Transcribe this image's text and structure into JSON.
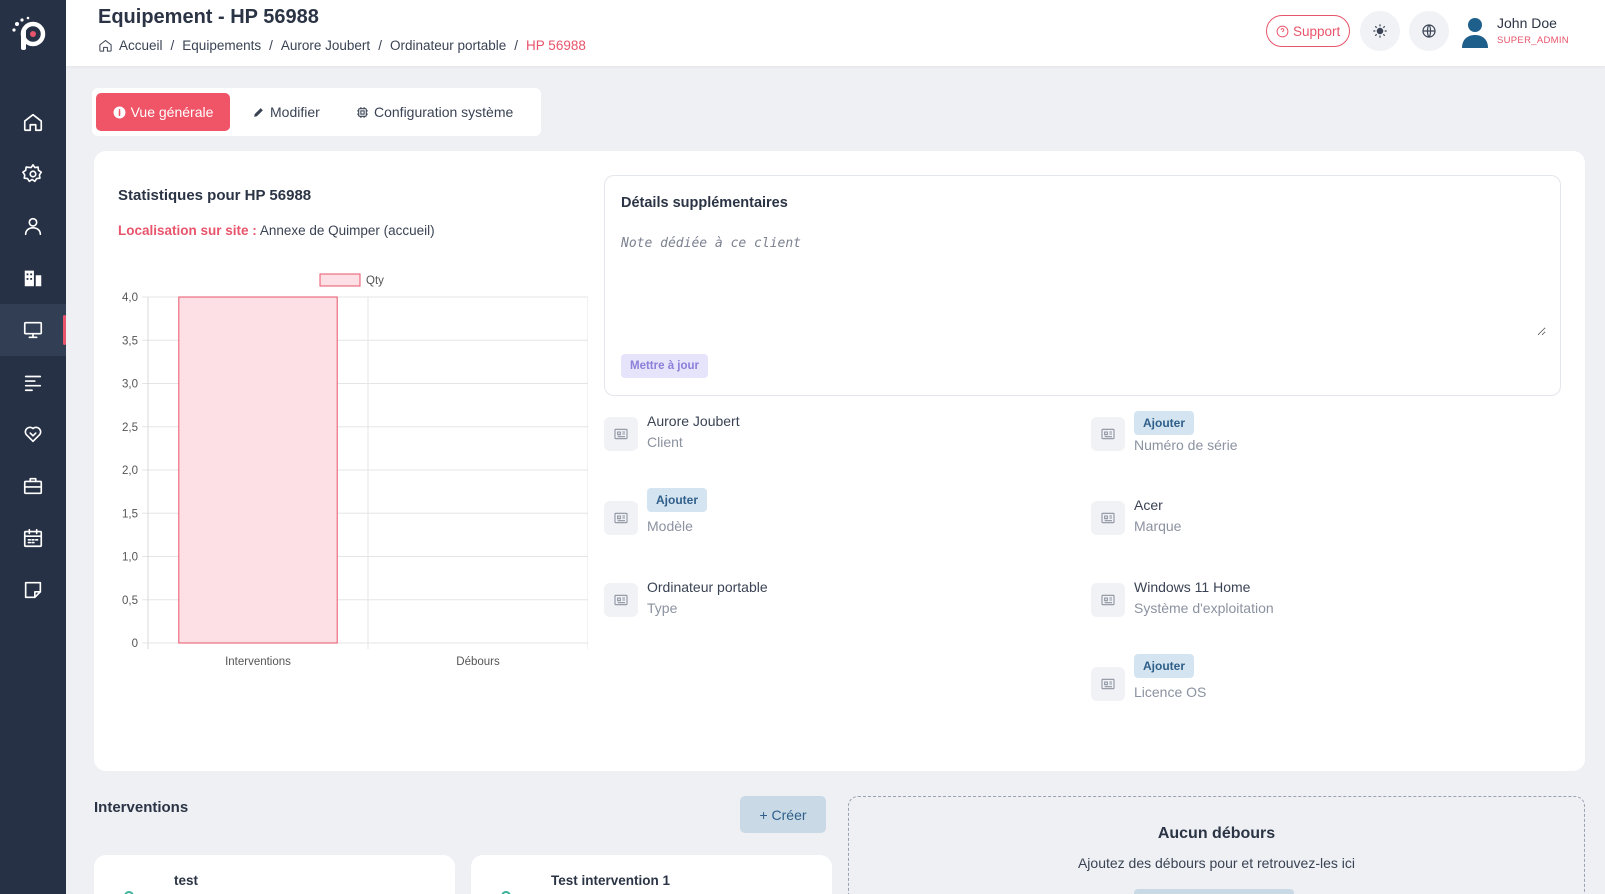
{
  "header": {
    "title": "Equipement - HP 56988",
    "breadcrumb": [
      "Accueil",
      "Equipements",
      "Aurore Joubert",
      "Ordinateur portable",
      "HP 56988"
    ],
    "support_label": "Support",
    "user": {
      "name": "John Doe",
      "role": "SUPER_ADMIN"
    }
  },
  "sidebar": {
    "items": [
      {
        "icon": "home-icon"
      },
      {
        "icon": "settings-icon"
      },
      {
        "icon": "user-icon"
      },
      {
        "icon": "building-icon"
      },
      {
        "icon": "monitor-icon",
        "active": true
      },
      {
        "icon": "list-icon"
      },
      {
        "icon": "heart-handshake-icon"
      },
      {
        "icon": "briefcase-icon"
      },
      {
        "icon": "calendar-icon"
      },
      {
        "icon": "sticky-note-icon"
      }
    ]
  },
  "tabs": [
    {
      "label": "Vue générale",
      "icon": "info-icon",
      "active": true
    },
    {
      "label": "Modifier",
      "icon": "pencil-icon"
    },
    {
      "label": "Configuration système",
      "icon": "cpu-icon"
    }
  ],
  "stats": {
    "title": "Statistiques pour HP 56988",
    "location_label": "Localisation sur site :",
    "location_value": "Annexe de Quimper (accueil)"
  },
  "chart_data": {
    "type": "bar",
    "categories": [
      "Interventions",
      "Débours"
    ],
    "series": [
      {
        "name": "Qty",
        "values": [
          4,
          0
        ]
      }
    ],
    "ylim": [
      0,
      4
    ],
    "yticks": [
      "0",
      "0,5",
      "1,0",
      "1,5",
      "2,0",
      "2,5",
      "3,0",
      "3,5",
      "4,0"
    ],
    "legend": "top",
    "grid": true,
    "colors": {
      "fill": "#fde0e5",
      "stroke": "#e8546b"
    }
  },
  "details": {
    "title": "Détails supplémentaires",
    "note_placeholder": "Note dédiée à ce client",
    "update_label": "Mettre à jour"
  },
  "info": {
    "add_label": "Ajouter",
    "client": {
      "value": "Aurore Joubert",
      "label": "Client"
    },
    "serial": {
      "label": "Numéro de série"
    },
    "model": {
      "label": "Modèle"
    },
    "brand": {
      "value": "Acer",
      "label": "Marque"
    },
    "type": {
      "value": "Ordinateur portable",
      "label": "Type"
    },
    "os": {
      "value": "Windows 11 Home",
      "label": "Système d'exploitation"
    },
    "license": {
      "label": "Licence OS"
    }
  },
  "interventions": {
    "title": "Interventions",
    "create_label": "+ Créer",
    "cards": [
      "test",
      "Test intervention 1"
    ]
  },
  "disbursements": {
    "empty_title": "Aucun débours",
    "empty_subtitle": "Ajoutez des débours pour et retrouvez-les ici"
  },
  "colors": {
    "accent": "#ef5467",
    "sidebar": "#263145",
    "badge": "#d4e4f0"
  }
}
